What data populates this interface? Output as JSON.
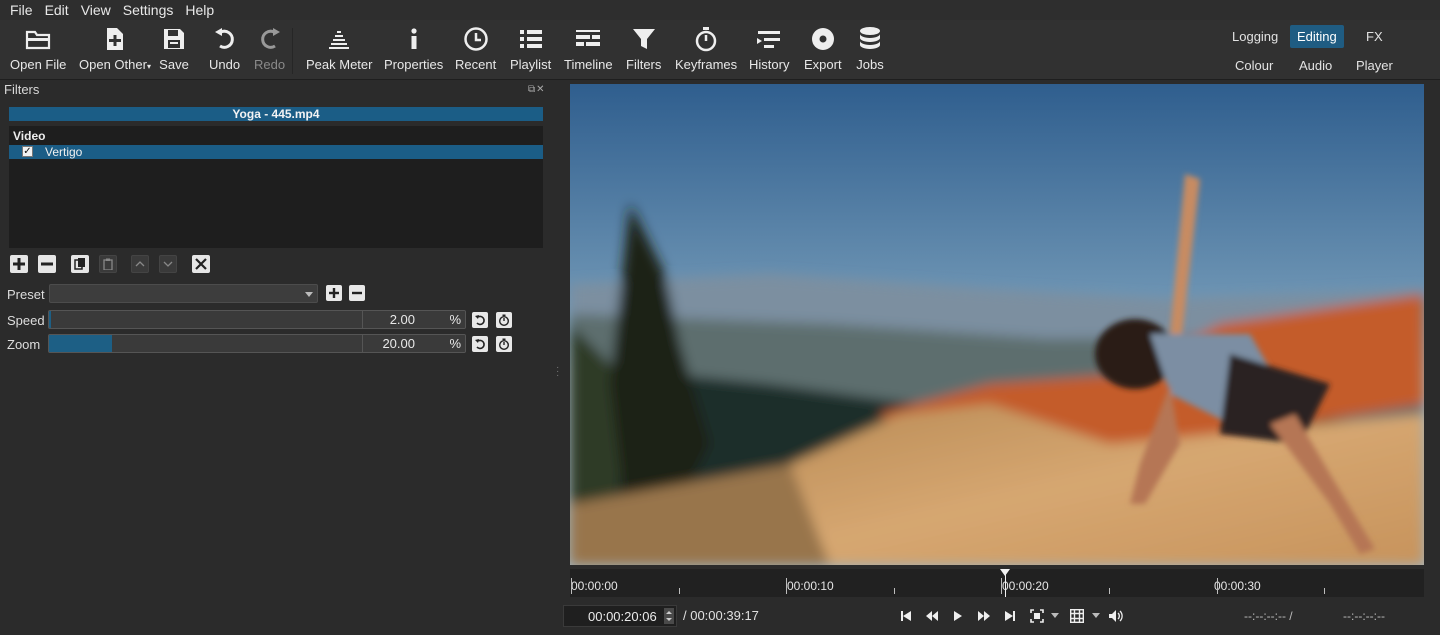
{
  "menu": [
    "File",
    "Edit",
    "View",
    "Settings",
    "Help"
  ],
  "toolbar": {
    "open_file": "Open File",
    "open_other": "Open Other",
    "save": "Save",
    "undo": "Undo",
    "redo": "Redo",
    "peak_meter": "Peak Meter",
    "properties": "Properties",
    "recent": "Recent",
    "playlist": "Playlist",
    "timeline": "Timeline",
    "filters": "Filters",
    "keyframes": "Keyframes",
    "history": "History",
    "export": "Export",
    "jobs": "Jobs"
  },
  "layouts": {
    "logging": "Logging",
    "editing": "Editing",
    "fx": "FX",
    "colour": "Colour",
    "audio": "Audio",
    "player": "Player",
    "active": "Editing"
  },
  "filters_panel": {
    "title": "Filters",
    "clip_name": "Yoga - 445.mp4",
    "category": "Video",
    "filter_name": "Vertigo",
    "filter_enabled": true,
    "preset_label": "Preset",
    "preset_value": "",
    "params": [
      {
        "label": "Speed",
        "value": "2.00",
        "unit": "%",
        "fraction": 0.005
      },
      {
        "label": "Zoom",
        "value": "20.00",
        "unit": "%",
        "fraction": 0.2
      }
    ]
  },
  "player": {
    "ruler_labels": [
      "00:00:00",
      "00:00:10",
      "00:00:20",
      "00:00:30"
    ],
    "position": "00:00:20:06",
    "duration": "/ 00:00:39:17",
    "in_point": "--:--:--:-- /",
    "out_point": "--:--:--:--"
  },
  "colors": {
    "accent": "#1b5d86",
    "background": "#2b2b2b"
  }
}
